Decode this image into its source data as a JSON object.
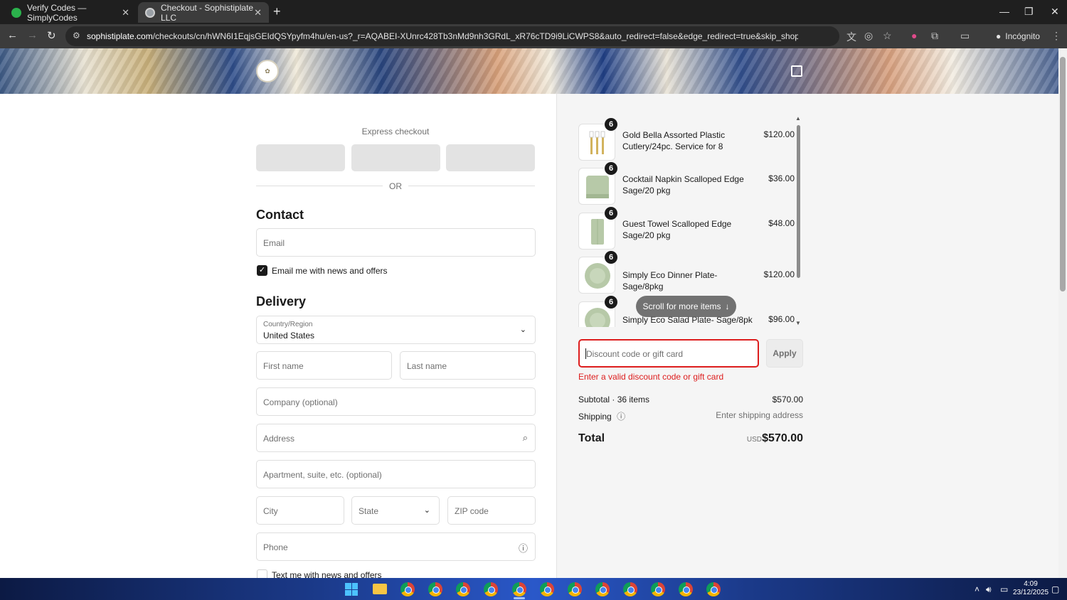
{
  "browser": {
    "tabs": [
      {
        "title": "Verify Codes — SimplyCodes",
        "active": false
      },
      {
        "title": "Checkout - Sophistiplate LLC",
        "active": true
      }
    ],
    "url_host": "sophistiplate.com",
    "url_path": "/checkouts/cn/hWN6I1EqjsGEIdQSYpyfm4hu/en-us?_r=AQABEI-XUnrc428Tb3nMd9nh3GRdL_xR76cTD9i9LiCWPS8&auto_redirect=false&edge_redirect=true&skip_shop_pay=true",
    "incognito_label": "Incógnito"
  },
  "checkout": {
    "express_label": "Express checkout",
    "or_label": "OR",
    "contact": {
      "heading": "Contact",
      "email_placeholder": "Email",
      "news_opt_in_label": "Email me with news and offers",
      "news_opt_in_checked": true
    },
    "delivery": {
      "heading": "Delivery",
      "country_label": "Country/Region",
      "country_value": "United States",
      "first_name_placeholder": "First name",
      "last_name_placeholder": "Last name",
      "company_placeholder": "Company (optional)",
      "address_placeholder": "Address",
      "apartment_placeholder": "Apartment, suite, etc. (optional)",
      "city_placeholder": "City",
      "state_placeholder": "State",
      "zip_placeholder": "ZIP code",
      "phone_placeholder": "Phone",
      "text_opt_in_label": "Text me with news and offers",
      "text_opt_in_checked": false
    }
  },
  "order_summary": {
    "items": [
      {
        "qty": "6",
        "name": "Gold Bella Assorted Plastic Cutlery/24pc. Service for 8",
        "price": "$120.00",
        "thumb": "cutlery"
      },
      {
        "qty": "6",
        "name": "Cocktail Napkin Scalloped Edge Sage/20 pkg",
        "price": "$36.00",
        "thumb": "napkin"
      },
      {
        "qty": "6",
        "name": "Guest Towel Scalloped Edge Sage/20 pkg",
        "price": "$48.00",
        "thumb": "towel"
      },
      {
        "qty": "6",
        "name": "Simply Eco Dinner Plate- Sage/8pkg",
        "price": "$120.00",
        "thumb": "plate"
      },
      {
        "qty": "6",
        "name": "Simply Eco Salad Plate- Sage/8pk",
        "price": "$96.00",
        "thumb": "plate"
      }
    ],
    "scroll_hint": "Scroll for more items",
    "discount_placeholder": "Discount code or gift card",
    "apply_label": "Apply",
    "discount_error": "Enter a valid discount code or gift card",
    "subtotal_label": "Subtotal · 36 items",
    "subtotal_value": "$570.00",
    "shipping_label": "Shipping",
    "shipping_value": "Enter shipping address",
    "total_label": "Total",
    "currency": "USD",
    "total_value": "$570.00"
  },
  "taskbar": {
    "time": "4:09",
    "date": "23/12/2025"
  },
  "colors": {
    "error": "#dd1d1d",
    "accent_dark": "#1a1a1a",
    "sage": "#b7c9a8"
  }
}
